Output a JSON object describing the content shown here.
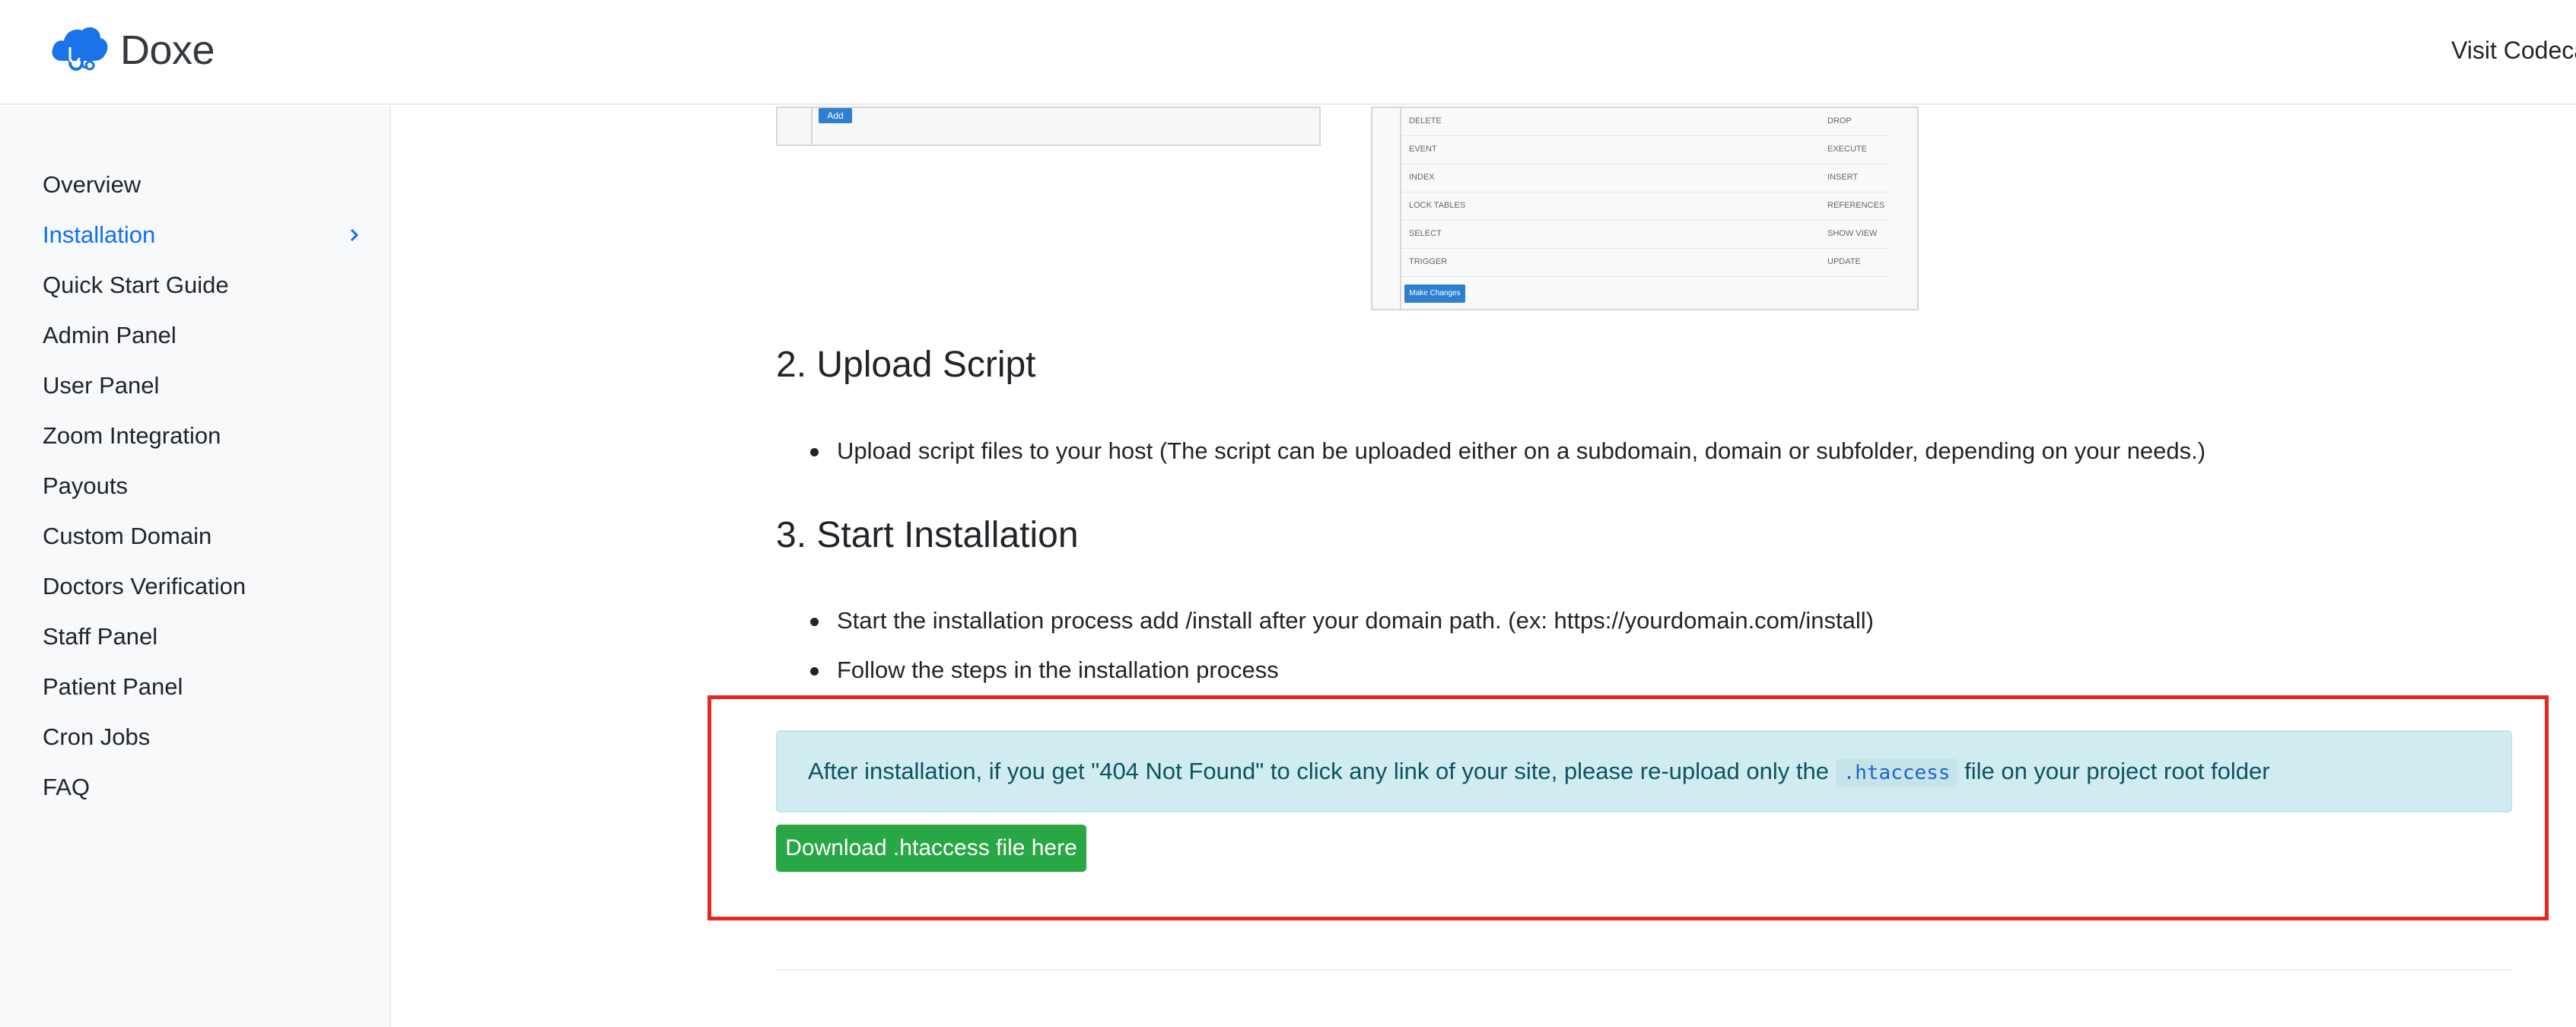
{
  "brand": {
    "name": "Doxe",
    "logo_icon": "cloud-stethoscope-icon"
  },
  "header": {
    "visit_link": "Visit Codeca"
  },
  "sidebar": {
    "items": [
      {
        "label": "Overview",
        "active": false
      },
      {
        "label": "Installation",
        "active": true
      },
      {
        "label": "Quick Start Guide",
        "active": false
      },
      {
        "label": "Admin Panel",
        "active": false
      },
      {
        "label": "User Panel",
        "active": false
      },
      {
        "label": "Zoom Integration",
        "active": false
      },
      {
        "label": "Payouts",
        "active": false
      },
      {
        "label": "Custom Domain",
        "active": false
      },
      {
        "label": "Doctors Verification",
        "active": false
      },
      {
        "label": "Staff Panel",
        "active": false
      },
      {
        "label": "Patient Panel",
        "active": false
      },
      {
        "label": "Cron Jobs",
        "active": false
      },
      {
        "label": "FAQ",
        "active": false
      }
    ],
    "active_color": "#0d6efd"
  },
  "screenshot_a": {
    "add_label": "Add"
  },
  "screenshot_b": {
    "rows": [
      {
        "left": "DELETE",
        "right": "DROP"
      },
      {
        "left": "EVENT",
        "right": "EXECUTE"
      },
      {
        "left": "INDEX",
        "right": "INSERT"
      },
      {
        "left": "LOCK TABLES",
        "right": "REFERENCES"
      },
      {
        "left": "SELECT",
        "right": "SHOW VIEW"
      },
      {
        "left": "TRIGGER",
        "right": "UPDATE"
      }
    ],
    "button_label": "Make Changes"
  },
  "sections": {
    "upload": {
      "title": "2. Upload Script",
      "bullets": [
        "Upload script files to your host (The script can be uploaded either on a subdomain, domain or subfolder, depending on your needs.)"
      ]
    },
    "install": {
      "title": "3. Start Installation",
      "bullets": [
        "Start the installation process add /install after your domain path. (ex: https://yourdomain.com/install)",
        "Follow the steps in the installation process"
      ]
    }
  },
  "alert": {
    "text_before": "After installation, if you get \"404 Not Found\" to click any link of your site, please re-upload only the ",
    "code": ".htaccess",
    "text_after": " file on your project root folder"
  },
  "download_button": {
    "label": "Download .htaccess file here",
    "color": "#28a745"
  },
  "highlight_color": "#e8281e"
}
